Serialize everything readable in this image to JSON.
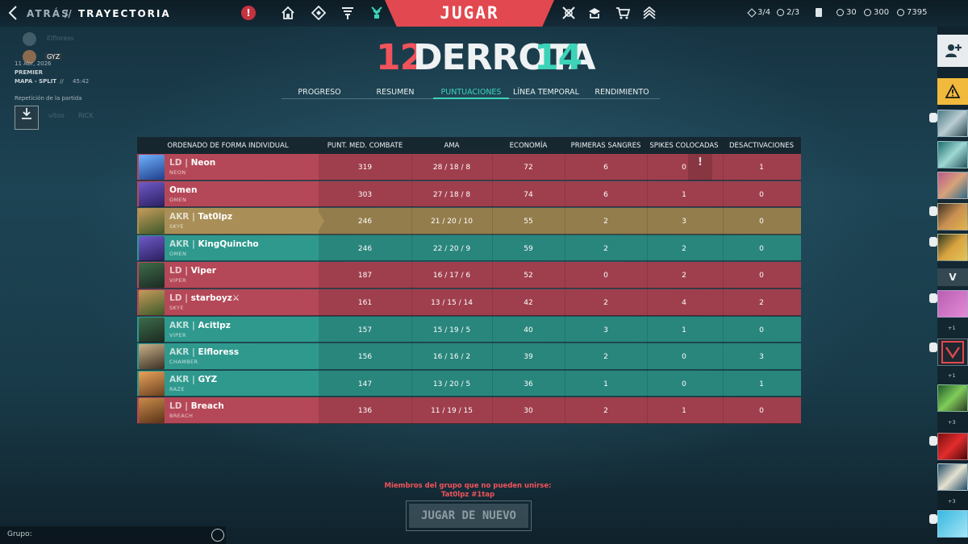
{
  "topbar": {
    "back_label": "ATRÁS",
    "separator": "//",
    "current_label": "TRAYECTORIA",
    "play_label": "JUGAR",
    "counters": [
      {
        "icon": "upgrade-token-icon",
        "value": "3/4"
      },
      {
        "icon": "gift-icon",
        "value": "2/3"
      },
      {
        "icon": "card-icon",
        "value": ""
      },
      {
        "icon": "valorant-points-icon",
        "value": "30"
      },
      {
        "icon": "radianite-icon",
        "value": "300"
      },
      {
        "icon": "kingdom-credits-icon",
        "value": "7395"
      }
    ],
    "nav_icons": [
      "home-icon",
      "agents-icon",
      "career-icon",
      "battlepass-icon",
      "esports-icon",
      "collection-icon",
      "store-icon",
      "rank-icon"
    ]
  },
  "left_panel": {
    "user_badge": "GYZ",
    "date": "11 Abr, 2026",
    "mode": "PREMIER",
    "map": "MAPA - SPLIT",
    "map_sep": "//",
    "duration": "45:42",
    "replay_label": "Repetición de la partida",
    "ghost_names": [
      "Elfloress",
      "vitoo",
      "RICK"
    ],
    "group_label": "Grupo:"
  },
  "score": {
    "left": "12",
    "result": "DERROTA",
    "right": "14",
    "colors": {
      "left": "#f0535b",
      "right": "#3cd3b8"
    }
  },
  "tabs": [
    {
      "label": "PROGRESO",
      "active": false
    },
    {
      "label": "RESUMEN",
      "active": false
    },
    {
      "label": "PUNTUACIONES",
      "active": true
    },
    {
      "label": "LÍNEA TEMPORAL",
      "active": false
    },
    {
      "label": "RENDIMIENTO",
      "active": false
    }
  ],
  "table": {
    "headers": [
      "ORDENADO DE FORMA INDIVIDUAL",
      "PUNT. MED. COMBATE",
      "AMA",
      "ECONOMÍA",
      "PRIMERAS SANGRES",
      "SPIKES COLOCADAS",
      "DESACTIVACIONES"
    ],
    "rows": [
      {
        "team": "red",
        "tag": "LD",
        "name": "Neon",
        "agent": "NEON",
        "acs": "319",
        "kda": "28 / 18 / 8",
        "econ": "72",
        "fb": "6",
        "plants": "0",
        "defuses": "1",
        "flag": "!"
      },
      {
        "team": "red",
        "tag": "",
        "name": "Omen",
        "agent": "OMEN",
        "acs": "303",
        "kda": "27 / 18 / 8",
        "econ": "74",
        "fb": "6",
        "plants": "1",
        "defuses": "0",
        "flag": ""
      },
      {
        "team": "gold",
        "tag": "AKR",
        "name": "Tat0lpz",
        "agent": "SKYE",
        "acs": "246",
        "kda": "21 / 20 / 10",
        "econ": "55",
        "fb": "2",
        "plants": "3",
        "defuses": "0",
        "flag": ""
      },
      {
        "team": "teal",
        "tag": "AKR",
        "name": "KingQuincho",
        "agent": "OMEN",
        "acs": "246",
        "kda": "22 / 20 / 9",
        "econ": "59",
        "fb": "2",
        "plants": "2",
        "defuses": "0",
        "flag": ""
      },
      {
        "team": "red",
        "tag": "LD",
        "name": "Viper",
        "agent": "VIPER",
        "acs": "187",
        "kda": "16 / 17 / 6",
        "econ": "52",
        "fb": "0",
        "plants": "2",
        "defuses": "0",
        "flag": ""
      },
      {
        "team": "red",
        "tag": "LD",
        "name": "starboyz⚔",
        "agent": "SKYE",
        "acs": "161",
        "kda": "13 / 15 / 14",
        "econ": "42",
        "fb": "2",
        "plants": "4",
        "defuses": "2",
        "flag": ""
      },
      {
        "team": "teal",
        "tag": "AKR",
        "name": "Acitlpz",
        "agent": "VIPER",
        "acs": "157",
        "kda": "15 / 19 / 5",
        "econ": "40",
        "fb": "3",
        "plants": "1",
        "defuses": "0",
        "flag": ""
      },
      {
        "team": "teal",
        "tag": "AKR",
        "name": "Elfloress",
        "agent": "CHAMBER",
        "acs": "156",
        "kda": "16 / 16 / 2",
        "econ": "39",
        "fb": "2",
        "plants": "0",
        "defuses": "3",
        "flag": ""
      },
      {
        "team": "teal",
        "tag": "AKR",
        "name": "GYZ",
        "agent": "RAZE",
        "acs": "147",
        "kda": "13 / 20 / 5",
        "econ": "36",
        "fb": "1",
        "plants": "0",
        "defuses": "1",
        "flag": ""
      },
      {
        "team": "red",
        "tag": "LD",
        "name": "Breach",
        "agent": "BREACH",
        "acs": "136",
        "kda": "11 / 19 / 15",
        "econ": "30",
        "fb": "2",
        "plants": "1",
        "defuses": "0",
        "flag": ""
      }
    ]
  },
  "footer": {
    "warning_line1": "Miembros del grupo que no pueden unirse:",
    "warning_line2": "Tat0lpz #1tap",
    "play_again_label": "JUGAR DE NUEVO"
  },
  "social": {
    "add_friend_icon": "add-friend-icon",
    "warning_icon": "warning-icon",
    "plus_counts": [
      "+1",
      "+1",
      "+3",
      "+3"
    ]
  }
}
